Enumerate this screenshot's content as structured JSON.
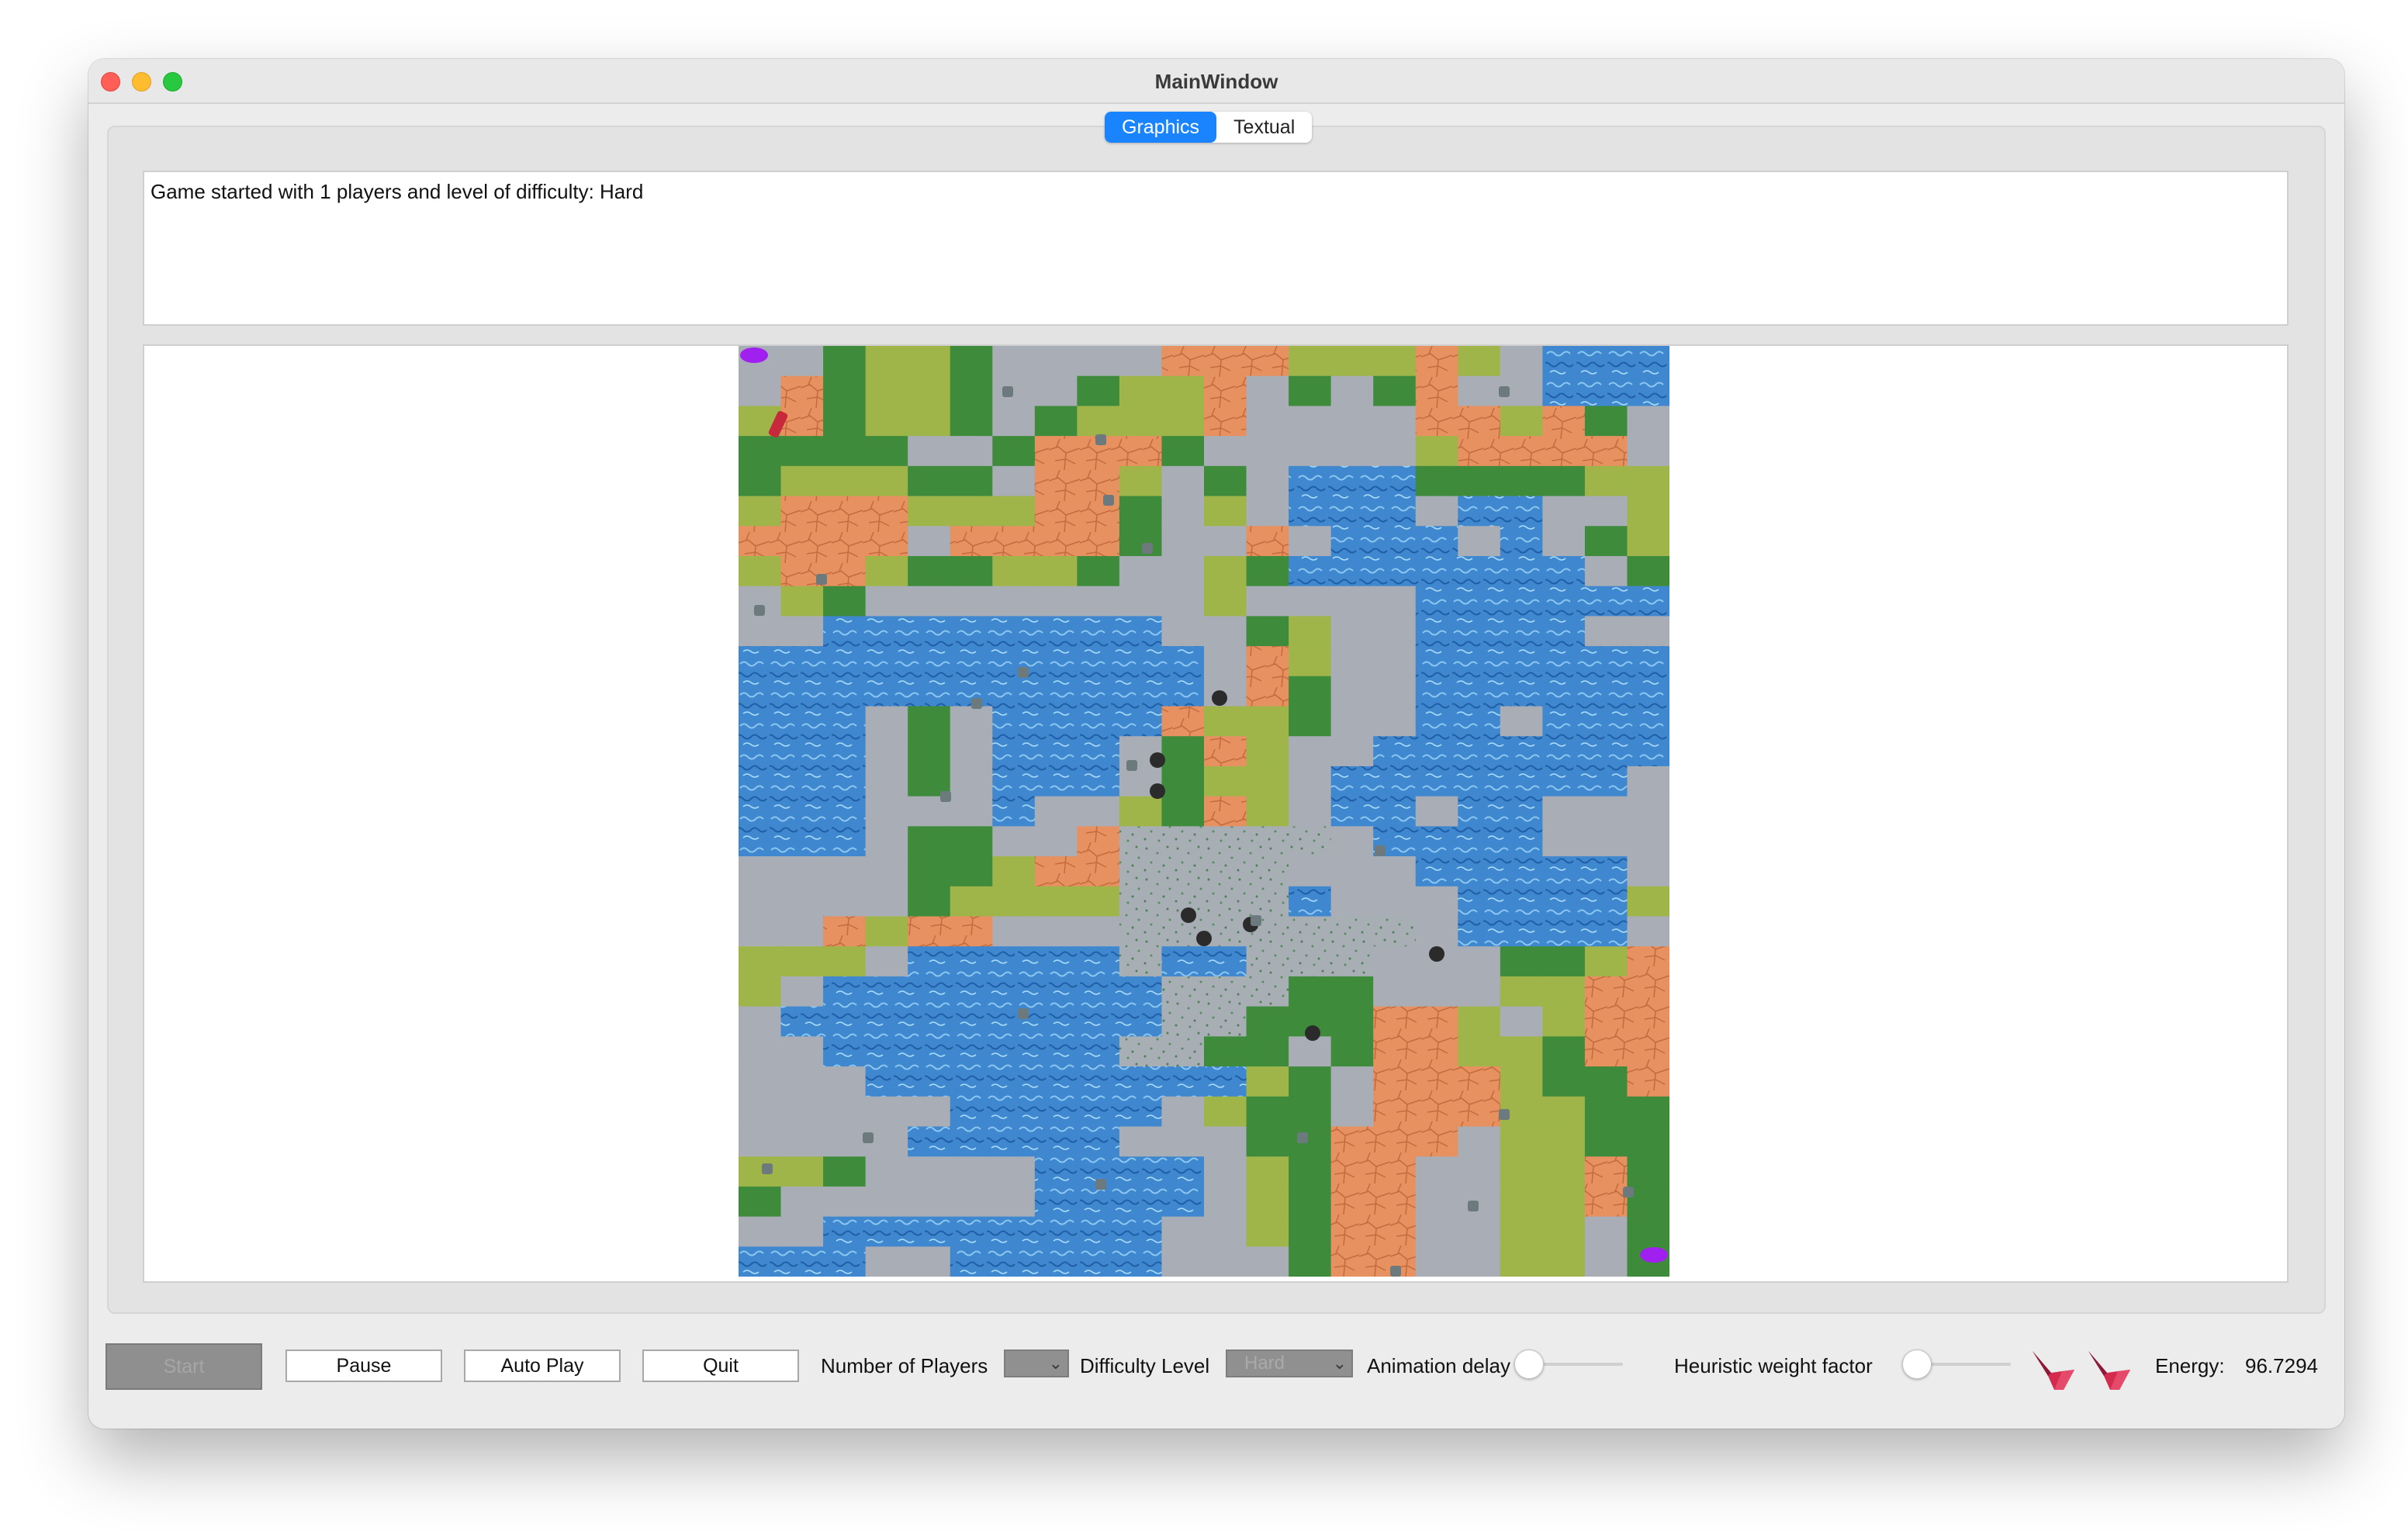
{
  "window": {
    "title": "MainWindow"
  },
  "tabs": [
    {
      "label": "Graphics",
      "active": true
    },
    {
      "label": "Textual",
      "active": false
    }
  ],
  "log": {
    "text": "Game started with 1 players and level of difficulty: Hard"
  },
  "map": {
    "legend": {
      "G": "dark grass",
      "L": "light grass",
      "D": "dirt",
      "R": "stone floor",
      "W": "water",
      "S": "swamp"
    },
    "rows": [
      "RRGLLGRRRRDDDLLLDLRWWW",
      "RDGLLGRRGLLDRGRGDRRWWW",
      "LDGLLGRGLLLDRRRRDDLDGR",
      "GGGGRRGDDDGRRRRRLDDDDR",
      "GLLLGGRDDLRGRWWWGGGGLL",
      "LDDDLLLDDGRLRWWWRWWRRL",
      "DDDDRDDDDGRRDRWWWRWRGL",
      "LDDLGGLLGRRLGWWWWWWWRG",
      "RLGRRRRRRRRLRRRRWWWWWW",
      "RRWWWWWWWWRRGLRRWWWWRR",
      "WWWWWWWWWWWRDLRRWWWWWW",
      "WWWWWWWWWWWRDGRRWWWWWW",
      "WWWRGRWWWWDLLGRRWWRWWW",
      "WWWRGRWWWRGDLRRWWWWWWW",
      "WWWRGRWWWRGLLRWWWWWWWR",
      "WWWRRRWRRLGDLRWWRWWRRR",
      "WWWRGGRRDSSSSSRWWWWRRR",
      "RRRRGGLDDSSSSRRRWWWWWR",
      "RRRRGLLLLSSSSWRRRWWWWL",
      "RRDLDDRRRSSSSSSSRWWWWR",
      "LLLRWWWWWSWWSSSRRRGGLD",
      "LRWWWWWWWWSSSGGRRRLLDD",
      "RWWWWWWWWWSSGGGDDLRLDD",
      "RRWWWWWWWSSGGRGDDLLGDD",
      "RRRWWWWWWWWWLGRDDDLGGD",
      "RRRRRWWWWWRLGGRDDDLLGG",
      "RRRRWWWWWRRRGGDDDRLLGG",
      "LLGRRRRWWWWRLGDDRRLLDG",
      "GRRRRRRWWWWRLGDDRRLLDG",
      "RRWWWWWWWWRRLGDDRRLLRG",
      "WWWRRWWWWWRRRGDDRRLLRG"
    ]
  },
  "controls": {
    "start_label": "Start",
    "pause_label": "Pause",
    "autoplay_label": "Auto Play",
    "quit_label": "Quit",
    "players_label": "Number of Players",
    "players_value": "",
    "difficulty_label": "Difficulty Level",
    "difficulty_value": "Hard",
    "animation_label": "Animation delay",
    "animation_value": 0,
    "heuristic_label": "Heuristic weight factor",
    "heuristic_value": 0,
    "energy_label": "Energy:",
    "energy_value": "96.7294"
  },
  "colors": {
    "accent": "#1a84ff",
    "crystal": "#d42a4e",
    "portal": "#a020f0"
  }
}
